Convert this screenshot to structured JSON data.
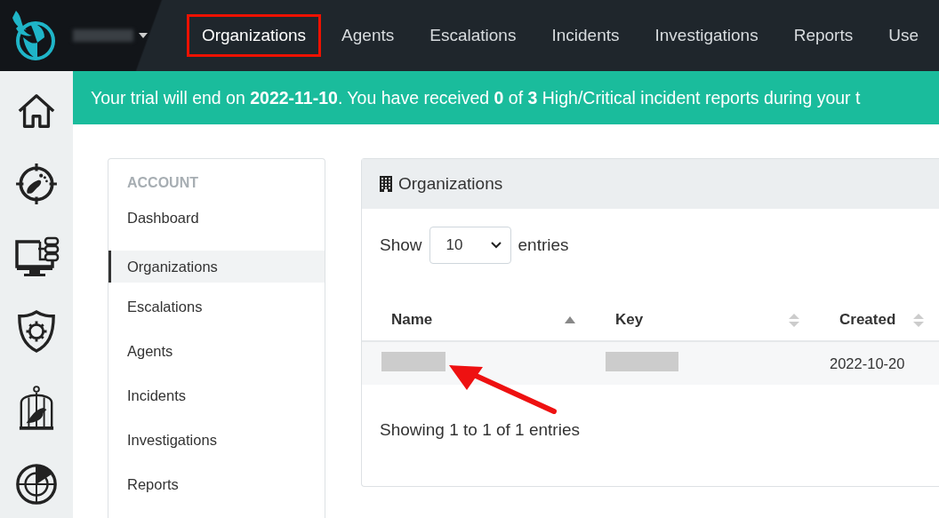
{
  "topbar": {
    "account": {
      "redacted": true
    },
    "nav": [
      {
        "label": "Organizations",
        "highlighted": true
      },
      {
        "label": "Agents",
        "highlighted": false
      },
      {
        "label": "Escalations",
        "highlighted": false
      },
      {
        "label": "Incidents",
        "highlighted": false
      },
      {
        "label": "Investigations",
        "highlighted": false
      },
      {
        "label": "Reports",
        "highlighted": false
      },
      {
        "label": "Use",
        "highlighted": false
      }
    ]
  },
  "banner": {
    "text": "Your trial will end on **2022-11-10**. You have received **0** of **3** High/Critical incident reports during your t"
  },
  "rail": [
    {
      "kind": "home"
    },
    {
      "kind": "footprint"
    },
    {
      "kind": "monitor"
    },
    {
      "kind": "shield"
    },
    {
      "kind": "cage"
    },
    {
      "kind": "radar"
    }
  ],
  "sidebar": {
    "heading": "ACCOUNT",
    "items": [
      {
        "label": "Dashboard",
        "selected": false
      },
      {
        "label": "Organizations",
        "selected": true
      },
      {
        "label": "Escalations",
        "selected": false
      },
      {
        "label": "Agents",
        "selected": false
      },
      {
        "label": "Incidents",
        "selected": false
      },
      {
        "label": "Investigations",
        "selected": false
      },
      {
        "label": "Reports",
        "selected": false
      }
    ]
  },
  "panel": {
    "title": "Organizations",
    "show_label": "Show",
    "page_size": "10",
    "entries_label": "entries",
    "table": {
      "columns": [
        {
          "label": "Name",
          "sorted": true
        },
        {
          "label": "Key",
          "sorted": false
        },
        {
          "label": "Created",
          "sorted": false
        }
      ],
      "rows": [
        {
          "cells": [
            {
              "kind": "redacted"
            },
            {
              "kind": "redacted"
            },
            {
              "kind": "text",
              "text": "2022-10-20"
            }
          ]
        }
      ]
    },
    "footer": "Showing 1 to 1 of 1 entries",
    "annotation": {
      "kind": "arrow"
    }
  }
}
